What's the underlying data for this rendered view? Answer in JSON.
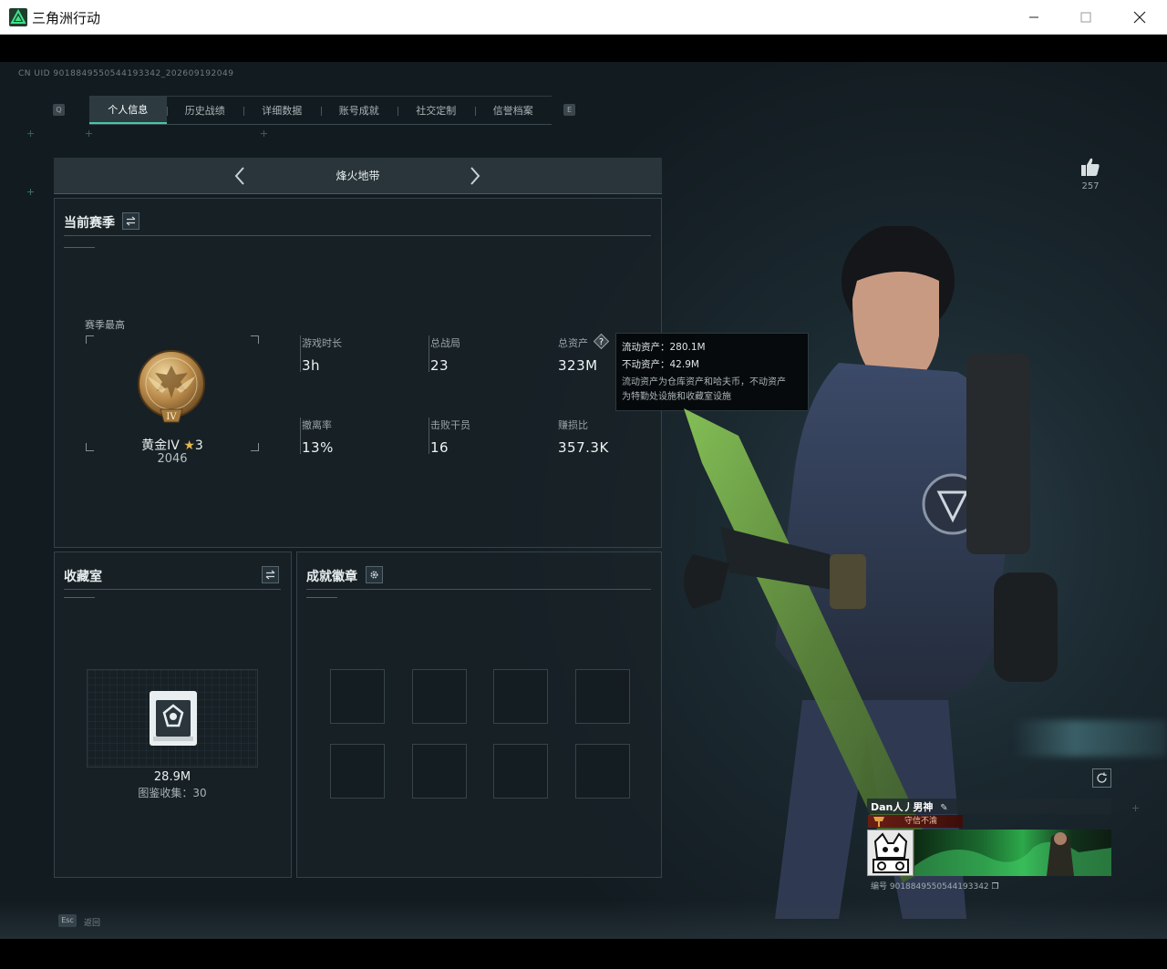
{
  "window": {
    "title": "三角洲行动",
    "minimize": "—",
    "maximize": "☐",
    "close": "✕"
  },
  "header": {
    "uid": "CN UID 9018849550544193342_202609192049",
    "tab_key_left": "Q",
    "tab_key_right": "E",
    "tabs": [
      {
        "label": "个人信息",
        "active": true
      },
      {
        "label": "历史战绩"
      },
      {
        "label": "详细数据"
      },
      {
        "label": "账号成就"
      },
      {
        "label": "社交定制"
      },
      {
        "label": "信誉档案"
      }
    ]
  },
  "likes": {
    "count": "257",
    "icon": "thumbs-up-icon"
  },
  "mode": {
    "label": "烽火地带",
    "prev_icon": "chevron-left-icon",
    "next_icon": "chevron-right-icon"
  },
  "season": {
    "title": "当前赛季",
    "best_label": "赛季最高",
    "rank_name": "黄金IV",
    "rank_stars": "3",
    "rank_score": "2046",
    "medal_numeral": "IV",
    "stats": [
      {
        "label": "游戏时长",
        "value": "3h"
      },
      {
        "label": "总战局",
        "value": "23"
      },
      {
        "label": "总资产",
        "value": "323M"
      },
      {
        "label": "撤离率",
        "value": "13%"
      },
      {
        "label": "击败干员",
        "value": "16"
      },
      {
        "label": "赚损比",
        "value": "357.3K"
      }
    ]
  },
  "tooltip": {
    "liquid": "流动资产：280.1M",
    "fixed": "不动资产：42.9M",
    "desc1": "流动资产为仓库资产和哈夫币，不动资产",
    "desc2": "为特勤处设施和收藏室设施"
  },
  "collection": {
    "title": "收藏室",
    "value": "28.9M",
    "count": "图鉴收集：30"
  },
  "achievements": {
    "title": "成就徽章",
    "slots": 8
  },
  "profile_card": {
    "name": "Dan人丿男神",
    "title": "守信不渝",
    "id": "编号 9018849550544193342"
  },
  "footer": {
    "esc_key": "Esc",
    "esc_label": "返回"
  },
  "colors": {
    "accent": "#48c7a8",
    "panel_bg": "#182126",
    "tooltip_bg": "#05080a",
    "gold": "#c89a52"
  }
}
